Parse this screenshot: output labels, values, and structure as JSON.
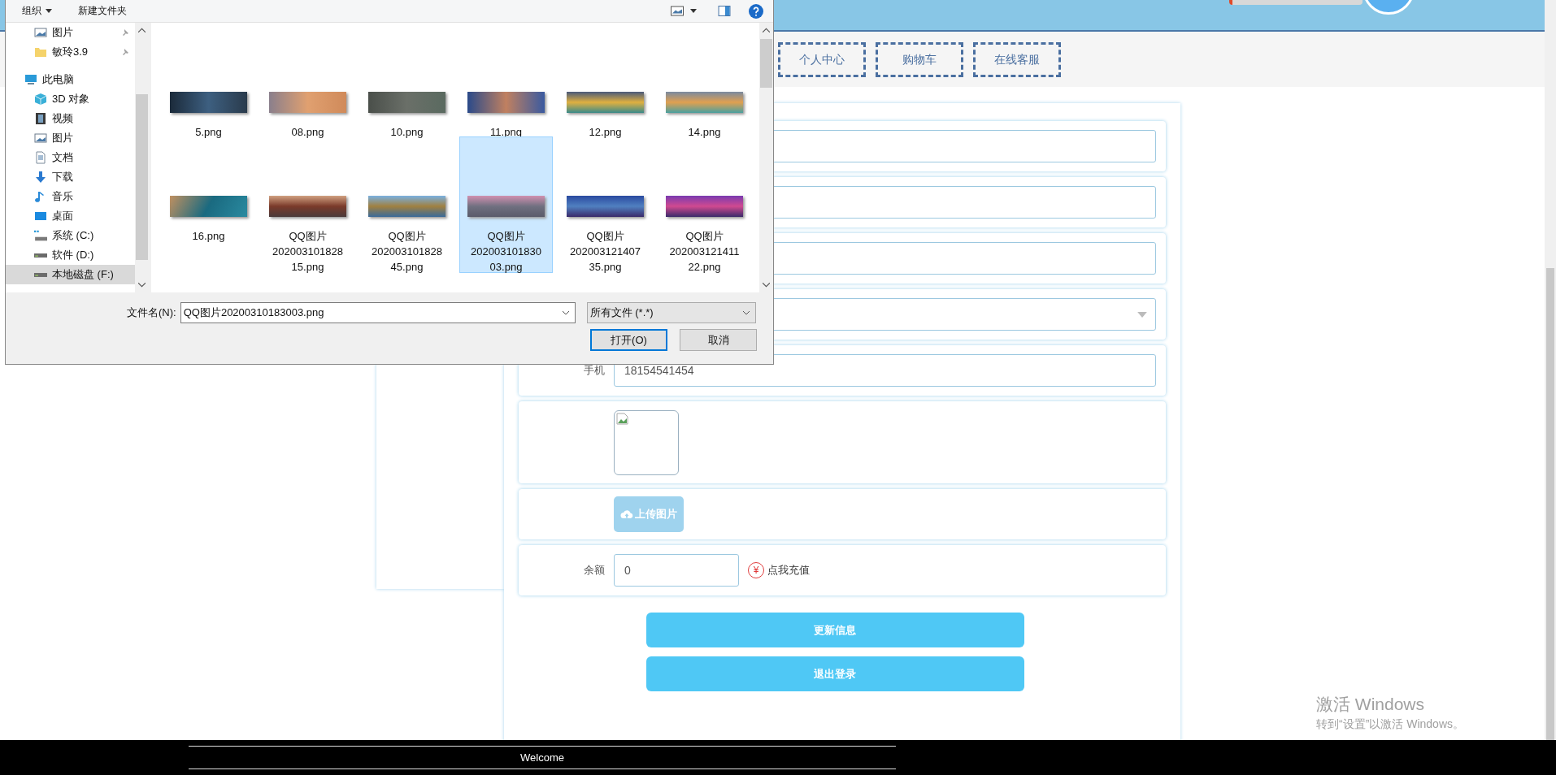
{
  "nav_buttons": [
    {
      "label": "个人中心"
    },
    {
      "label": "购物车"
    },
    {
      "label": "在线客服"
    }
  ],
  "form": {
    "rows": [
      {
        "kind": "text"
      },
      {
        "kind": "text"
      },
      {
        "kind": "text"
      },
      {
        "kind": "select"
      },
      {
        "kind": "text",
        "label": "手机",
        "value": "18154541454"
      },
      {
        "kind": "image"
      },
      {
        "kind": "upload",
        "button": "上传图片"
      },
      {
        "kind": "balance",
        "label": "余额",
        "value": "0",
        "recharge_icon": "¥",
        "recharge_link": "点我充值"
      }
    ],
    "buttons": [
      "更新信息",
      "退出登录"
    ]
  },
  "footer": {
    "text": "Welcome"
  },
  "os_notice": {
    "title": "激活 Windows",
    "subtitle": "转到“设置”以激活 Windows。"
  },
  "file_dialog": {
    "toolbar": {
      "organize": "组织",
      "new_folder": "新建文件夹"
    },
    "quick_access": [
      {
        "label": "图片",
        "kind": "pictures",
        "pinned": true,
        "selected": false
      },
      {
        "label": "敏玲3.9",
        "kind": "folder",
        "pinned": true,
        "selected": false
      }
    ],
    "this_pc": {
      "label": "此电脑",
      "kind": "computer",
      "selected": false,
      "children": [
        {
          "label": "3D 对象",
          "kind": "objects",
          "selected": false
        },
        {
          "label": "视频",
          "kind": "videos",
          "selected": false
        },
        {
          "label": "图片",
          "kind": "pictures",
          "selected": false
        },
        {
          "label": "文档",
          "kind": "documents",
          "selected": false
        },
        {
          "label": "下载",
          "kind": "downloads",
          "selected": false
        },
        {
          "label": "音乐",
          "kind": "music",
          "selected": false
        },
        {
          "label": "桌面",
          "kind": "desktop",
          "selected": false
        },
        {
          "label": "系统 (C:)",
          "kind": "system-drive",
          "selected": false
        },
        {
          "label": "软件 (D:)",
          "kind": "drive",
          "selected": false
        },
        {
          "label": "本地磁盘 (F:)",
          "kind": "drive",
          "selected": true
        }
      ]
    },
    "files": [
      {
        "lines": [
          "5.png"
        ],
        "selected": false
      },
      {
        "lines": [
          "08.png"
        ],
        "selected": false
      },
      {
        "lines": [
          "10.png"
        ],
        "selected": false
      },
      {
        "lines": [
          "11.png"
        ],
        "selected": false
      },
      {
        "lines": [
          "12.png"
        ],
        "selected": false
      },
      {
        "lines": [
          "14.png"
        ],
        "selected": false
      },
      {
        "lines": [
          "16.png"
        ],
        "selected": false
      },
      {
        "lines": [
          "QQ图片",
          "202003101828",
          "15.png"
        ],
        "selected": false
      },
      {
        "lines": [
          "QQ图片",
          "202003101828",
          "45.png"
        ],
        "selected": false
      },
      {
        "lines": [
          "QQ图片",
          "202003101830",
          "03.png"
        ],
        "selected": true
      },
      {
        "lines": [
          "QQ图片",
          "202003121407",
          "35.png"
        ],
        "selected": false
      },
      {
        "lines": [
          "QQ图片",
          "202003121411",
          "22.png"
        ],
        "selected": false
      }
    ],
    "filename_label": "文件名(N):",
    "filename_value": "QQ图片20200310183003.png",
    "filter": "所有文件 (*.*)",
    "open_button": "打开(O)",
    "cancel_button": "取消"
  }
}
